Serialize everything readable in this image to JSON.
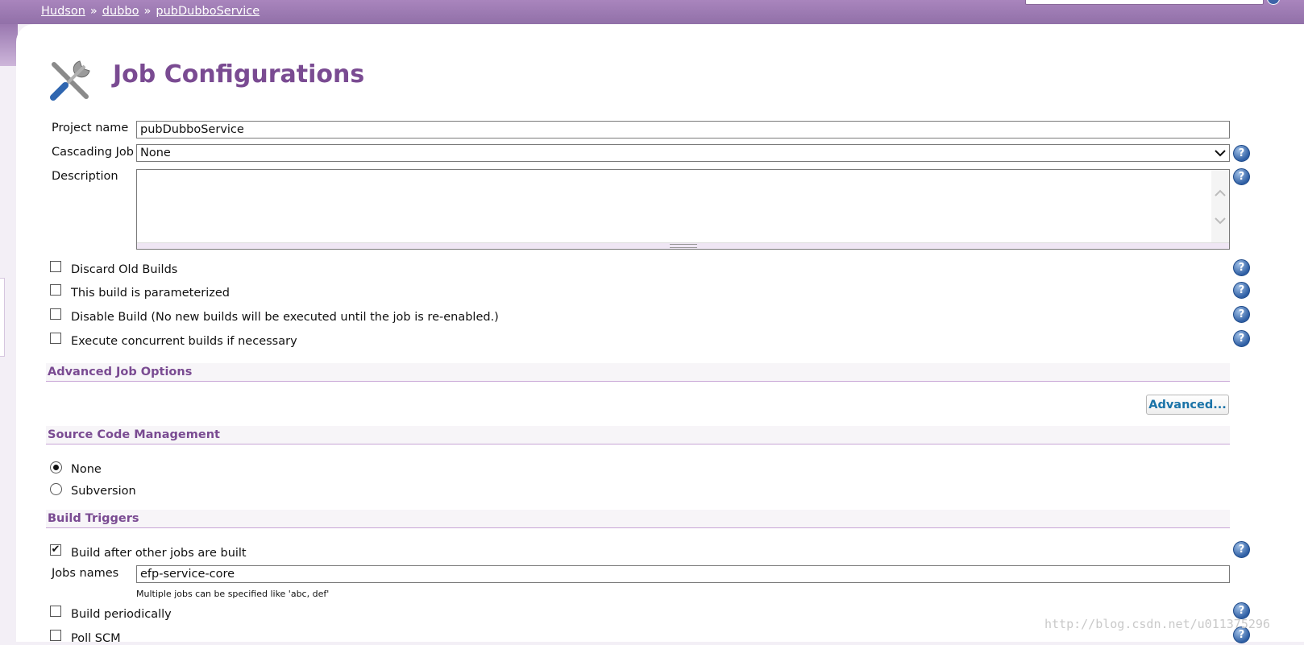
{
  "breadcrumb": [
    "Hudson",
    "dubbo",
    "pubDubboService"
  ],
  "breadcrumb_separator": "»",
  "page_title": "Job Configurations",
  "form": {
    "project_name_label": "Project name",
    "project_name_value": "pubDubboService",
    "cascading_label": "Cascading Job",
    "cascading_value": "None",
    "description_label": "Description"
  },
  "checkboxes": [
    {
      "label": "Discard Old Builds",
      "checked": false
    },
    {
      "label": "This build is parameterized",
      "checked": false
    },
    {
      "label": "Disable Build (No new builds will be executed until the job is re-enabled.)",
      "checked": false
    },
    {
      "label": "Execute concurrent builds if necessary",
      "checked": false
    }
  ],
  "sections": {
    "advanced": "Advanced Job Options",
    "scm": "Source Code Management",
    "triggers": "Build Triggers"
  },
  "advanced_button": "Advanced...",
  "scm_options": [
    {
      "label": "None",
      "selected": true
    },
    {
      "label": "Subversion",
      "selected": false
    }
  ],
  "triggers": {
    "after_other": {
      "label": "Build after other jobs are built",
      "checked": true
    },
    "jobs_names_label": "Jobs names",
    "jobs_names_value": "efp-service-core",
    "jobs_hint": "Multiple jobs can be specified like 'abc, def'",
    "periodically": {
      "label": "Build periodically",
      "checked": false
    },
    "poll_scm": {
      "label": "Poll SCM",
      "checked": false
    }
  },
  "help_symbol": "?",
  "watermark": "http://blog.csdn.net/u011375296",
  "colors": {
    "accent": "#7a4b92",
    "header": "#9a78b0",
    "link_button": "#1a73a8",
    "help": "#2f5fa4"
  }
}
